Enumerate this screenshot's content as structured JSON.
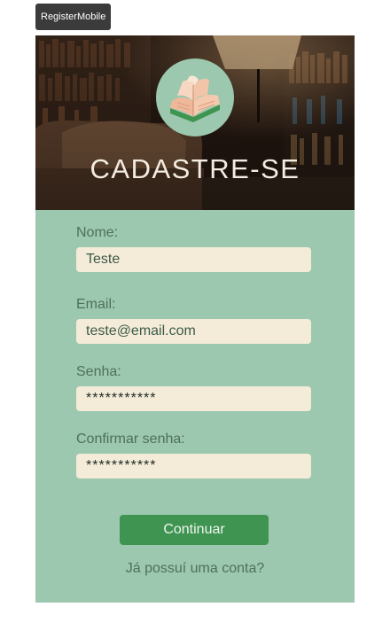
{
  "story_badge": "RegisterMobile",
  "header": {
    "title": "CADASTRE-SE",
    "logo_icon": "open-book-icon"
  },
  "form": {
    "name": {
      "label": "Nome:",
      "value": "Teste"
    },
    "email": {
      "label": "Email:",
      "value": "teste@email.com"
    },
    "password": {
      "label": "Senha:",
      "value": "***********"
    },
    "confirm_password": {
      "label": "Confirmar senha:",
      "value": "***********"
    }
  },
  "actions": {
    "continue_label": "Continuar",
    "login_link": "Já possuí uma conta?"
  },
  "colors": {
    "panel_bg": "#9bc8ae",
    "input_bg": "#f4ecd8",
    "button_bg": "#3f9451",
    "label_text": "#4f6f5c",
    "title_text": "#f4ece0"
  }
}
